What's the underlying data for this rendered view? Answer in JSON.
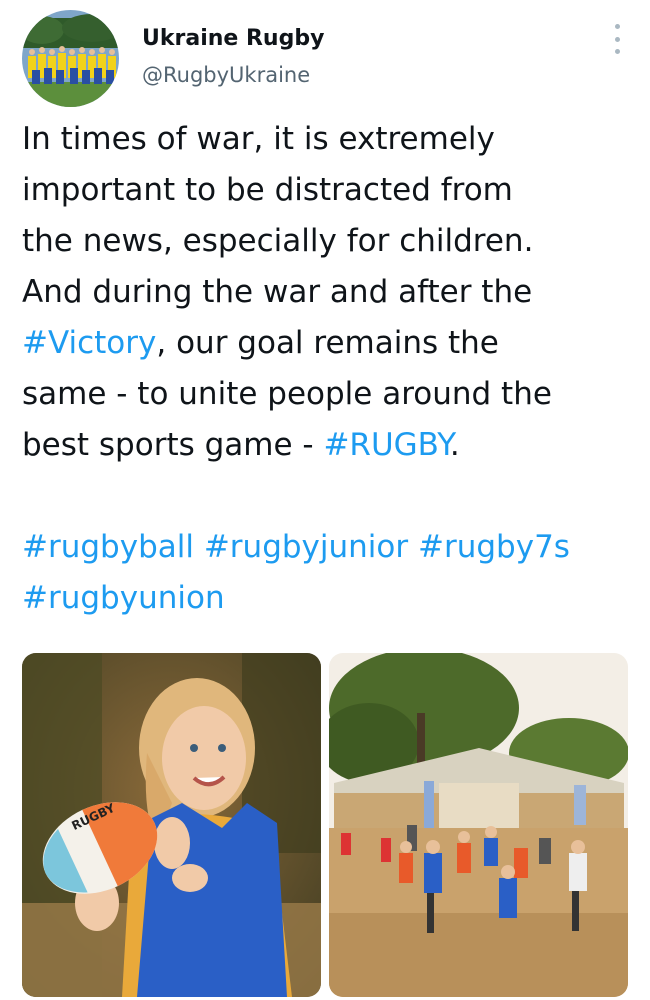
{
  "account": {
    "display_name": "Ukraine Rugby",
    "handle": "@RugbyUkraine"
  },
  "tweet": {
    "text_lines": [
      "In times of war, it is extremely",
      "important to be distracted from",
      "the news, especially for children.",
      "And during the war and after the"
    ],
    "hashtag_victory": "#Victory",
    "line5_rest": ", our goal remains the",
    "line6": "same - to unite people around the",
    "line7_start": "best sports game - ",
    "hashtag_rugby": "#RUGBY",
    "line7_end": ".",
    "hashtags_line1": [
      "#rugbyball",
      "#rugbyjunior",
      "#rugby7s"
    ],
    "hashtags_line2": [
      "#rugbyunion"
    ]
  },
  "media": {
    "ball_text": "RUGBY"
  },
  "colors": {
    "hashtag": "#1d9bf0",
    "handle": "#536471"
  }
}
